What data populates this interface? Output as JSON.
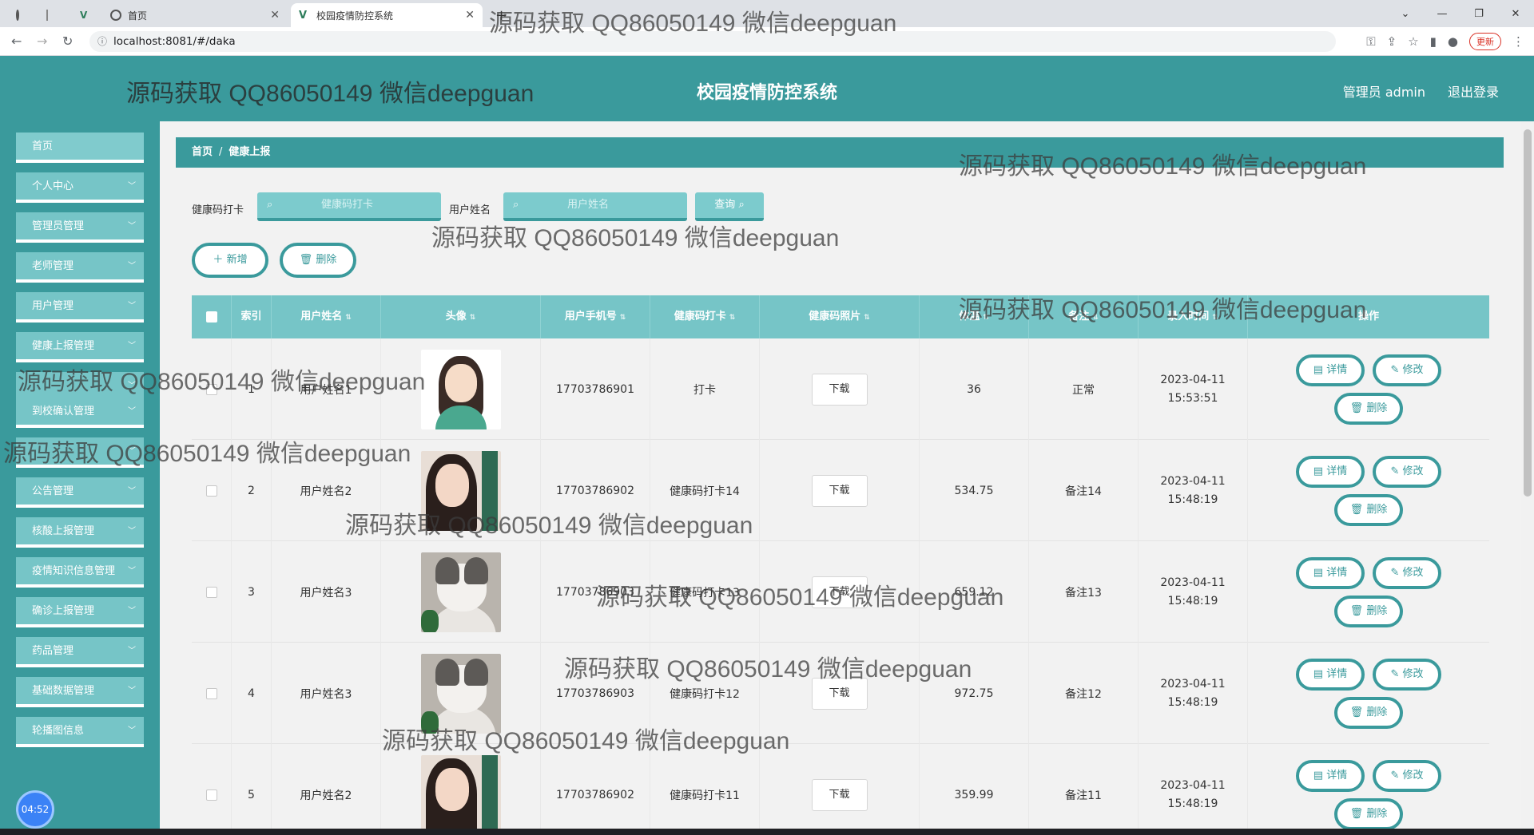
{
  "browser": {
    "tabs": [
      {
        "label": "首页"
      },
      {
        "label": "校园疫情防控系统"
      }
    ],
    "url": "localhost:8081/#/daka",
    "update_label": "更新"
  },
  "header": {
    "title": "校园疫情防控系统",
    "user": "管理员 admin",
    "logout": "退出登录"
  },
  "sidebar": {
    "items": [
      {
        "label": "首页"
      },
      {
        "label": "个人中心"
      },
      {
        "label": "管理员管理"
      },
      {
        "label": "老师管理"
      },
      {
        "label": "用户管理"
      },
      {
        "label": "健康上报管理"
      },
      {
        "label": ""
      },
      {
        "label": "到校确认管理"
      },
      {
        "label": ""
      },
      {
        "label": "公告管理"
      },
      {
        "label": "核酸上报管理"
      },
      {
        "label": "疫情知识信息管理"
      },
      {
        "label": "确诊上报管理"
      },
      {
        "label": "药品管理"
      },
      {
        "label": "基础数据管理"
      },
      {
        "label": "轮播图信息"
      }
    ],
    "clock": "04:52"
  },
  "breadcrumb": {
    "home": "首页",
    "sep": "/",
    "current": "健康上报"
  },
  "search": {
    "label1": "健康码打卡",
    "placeholder1": "健康码打卡",
    "label2": "用户姓名",
    "placeholder2": "用户姓名",
    "query": "查询"
  },
  "actions": {
    "add": "新增",
    "delete": "删除"
  },
  "table": {
    "headers": [
      "索引",
      "用户姓名",
      "头像",
      "用户手机号",
      "健康码打卡",
      "健康码照片",
      "体温",
      "备注",
      "录入时间",
      "操作"
    ],
    "download_label": "下载",
    "op_detail": "详情",
    "op_edit": "修改",
    "op_delete": "删除",
    "rows": [
      {
        "index": "1",
        "name": "用户姓名1",
        "avatar": "girl-cartoon",
        "phone": "17703786901",
        "checkin": "打卡",
        "temp": "36",
        "note": "正常",
        "time": "2023-04-11 15:53:51"
      },
      {
        "index": "2",
        "name": "用户姓名2",
        "avatar": "girl-portrait",
        "phone": "17703786902",
        "checkin": "健康码打卡14",
        "temp": "534.75",
        "note": "备注14",
        "time": "2023-04-11 15:48:19"
      },
      {
        "index": "3",
        "name": "用户姓名3",
        "avatar": "cat",
        "phone": "17703786903",
        "checkin": "健康码打卡13",
        "temp": "659.12",
        "note": "备注13",
        "time": "2023-04-11 15:48:19"
      },
      {
        "index": "4",
        "name": "用户姓名3",
        "avatar": "cat",
        "phone": "17703786903",
        "checkin": "健康码打卡12",
        "temp": "972.75",
        "note": "备注12",
        "time": "2023-04-11 15:48:19"
      },
      {
        "index": "5",
        "name": "用户姓名2",
        "avatar": "girl-portrait",
        "phone": "17703786902",
        "checkin": "健康码打卡11",
        "temp": "359.99",
        "note": "备注11",
        "time": "2023-04-11 15:48:19"
      }
    ]
  },
  "watermark": "源码获取 QQ86050149 微信deepguan",
  "colors": {
    "primary": "#3a9a9c",
    "light": "#76c5c7"
  }
}
